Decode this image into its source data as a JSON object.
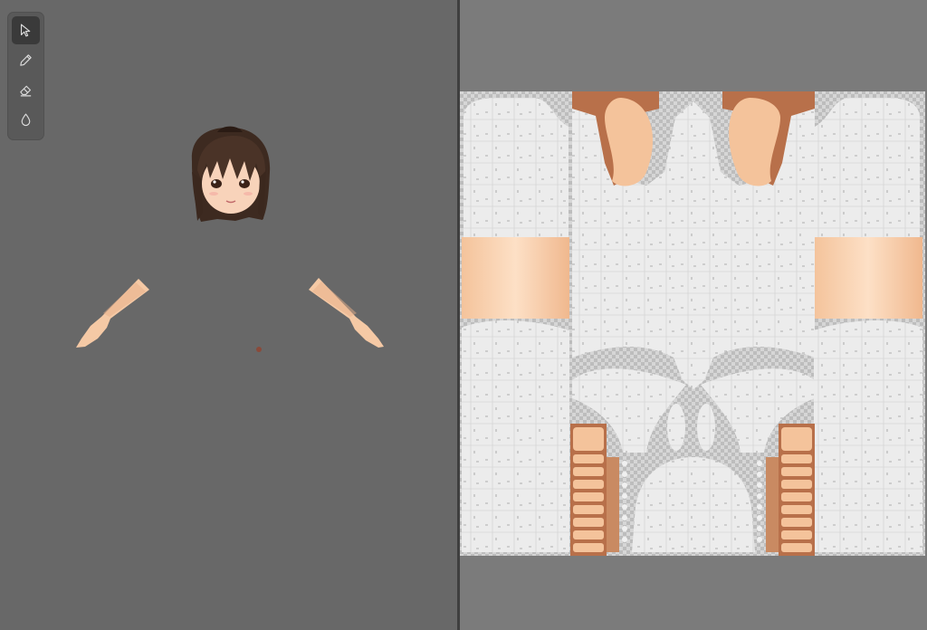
{
  "app": {
    "tools": [
      {
        "id": "select",
        "icon": "cursor-arrow-icon",
        "active": true
      },
      {
        "id": "pencil",
        "icon": "pencil-icon",
        "active": false
      },
      {
        "id": "eraser",
        "icon": "eraser-icon",
        "active": false
      },
      {
        "id": "fill",
        "icon": "drop-icon",
        "active": false
      }
    ]
  },
  "colors": {
    "viewport_bg": "#686868",
    "uv_panel_bg": "#7b7b7b",
    "divider": "#3f3f3f",
    "toolbar_bg": "#595959",
    "active_tool_bg": "#3a3a3a",
    "icon_color": "#dcdcdc",
    "skin": "#f5c9a5",
    "skin_shadow": "#e0a077",
    "hair": "#4a3327",
    "hair_dark": "#2a1b14",
    "uv_fill": "#e8e8e8",
    "uv_checker": "#bdbdbd",
    "uv_brown": "#b8704a"
  }
}
